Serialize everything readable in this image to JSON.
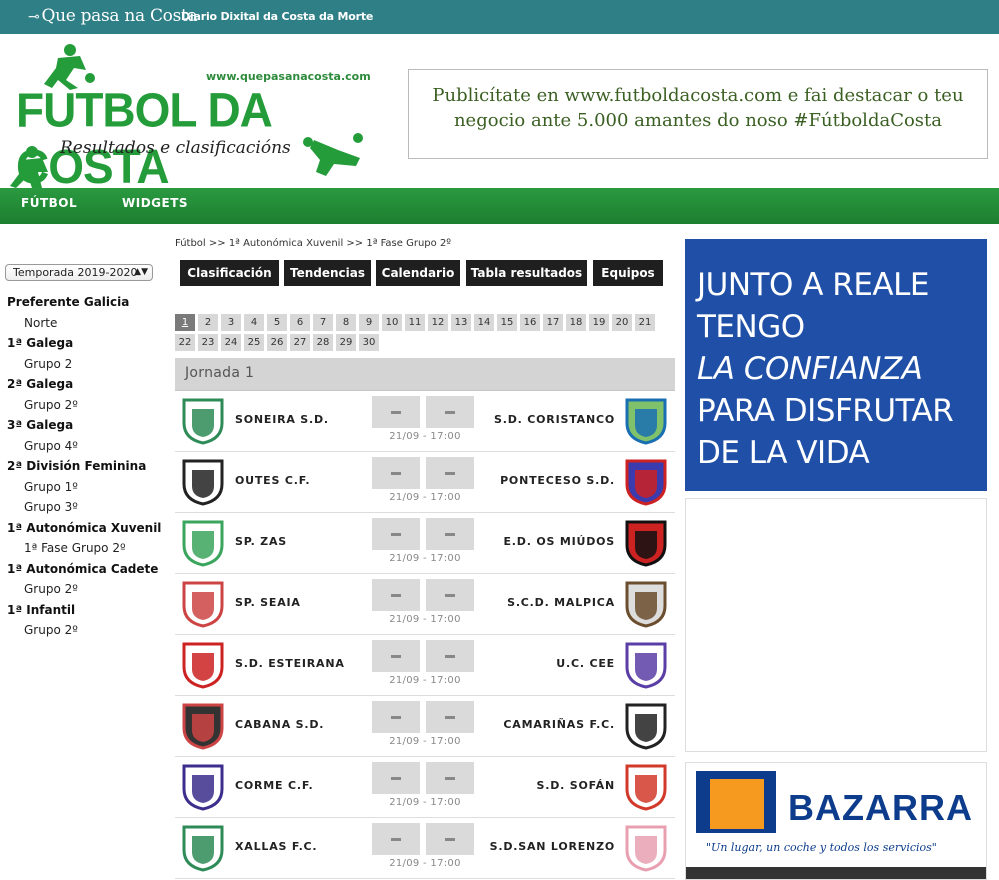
{
  "topbar": {
    "brand": "Que pasa na Costa",
    "tagline": "Diario Dixital da Costa da Morte"
  },
  "logo": {
    "url": "www.quepasanacosta.com",
    "title": "FUTBOL DA COSTA",
    "subtitle": "Resultados e clasificacións"
  },
  "header_ad": {
    "line1": "Publicítate en www.futboldacosta.com e fai destacar o teu",
    "line2": "negocio ante 5.000 amantes do noso #FútboldaCosta"
  },
  "nav": [
    "FÚTBOL",
    "WIDGETS"
  ],
  "season": "Temporada 2019-2020",
  "sidebar": [
    {
      "type": "cat",
      "label": "Preferente Galicia"
    },
    {
      "type": "grp",
      "label": "Norte"
    },
    {
      "type": "cat",
      "label": "1ª Galega"
    },
    {
      "type": "grp",
      "label": "Grupo 2"
    },
    {
      "type": "cat",
      "label": "2ª Galega"
    },
    {
      "type": "grp",
      "label": "Grupo 2º"
    },
    {
      "type": "cat",
      "label": "3ª Galega"
    },
    {
      "type": "grp",
      "label": "Grupo 4º"
    },
    {
      "type": "cat",
      "label": "2ª División Feminina"
    },
    {
      "type": "grp",
      "label": "Grupo 1º"
    },
    {
      "type": "grp",
      "label": "Grupo 3º"
    },
    {
      "type": "cat",
      "label": "1ª Autonómica Xuvenil"
    },
    {
      "type": "grp",
      "label": "1ª Fase Grupo 2º"
    },
    {
      "type": "cat",
      "label": "1ª Autonómica Cadete"
    },
    {
      "type": "grp",
      "label": "Grupo 2º"
    },
    {
      "type": "cat",
      "label": "1ª Infantil"
    },
    {
      "type": "grp",
      "label": "Grupo 2º"
    }
  ],
  "breadcrumb": "Fútbol  >> 1ª Autonómica Xuvenil  >> 1ª Fase Grupo 2º",
  "tabs": [
    "Clasificación",
    "Tendencias",
    "Calendario",
    "Tabla resultados",
    "Equipos"
  ],
  "rounds": [
    "1",
    "2",
    "3",
    "4",
    "5",
    "6",
    "7",
    "8",
    "9",
    "10",
    "11",
    "12",
    "13",
    "14",
    "15",
    "16",
    "17",
    "18",
    "19",
    "20",
    "21",
    "22",
    "23",
    "24",
    "25",
    "26",
    "27",
    "28",
    "29",
    "30"
  ],
  "selected_round": "1",
  "jornada_title": "Jornada 1",
  "matches": [
    {
      "home": "SONEIRA S.D.",
      "away": "S.D. CORISTANCO",
      "when": "21/09 - 17:00"
    },
    {
      "home": "OUTES C.F.",
      "away": "PONTECESO S.D.",
      "when": "21/09 - 17:00"
    },
    {
      "home": "SP. ZAS",
      "away": "E.D. OS MIÚDOS",
      "when": "21/09 - 17:00"
    },
    {
      "home": "SP. SEAIA",
      "away": "S.C.D. MALPICA",
      "when": "21/09 - 17:00"
    },
    {
      "home": "S.D. ESTEIRANA",
      "away": "U.C. CEE",
      "when": "21/09 - 17:00"
    },
    {
      "home": "CABANA S.D.",
      "away": "CAMARIÑAS F.C.",
      "when": "21/09 - 17:00"
    },
    {
      "home": "CORME C.F.",
      "away": "S.D. SOFÁN",
      "when": "21/09 - 17:00"
    },
    {
      "home": "XALLAS F.C.",
      "away": "S.D.SAN LORENZO",
      "when": "21/09 - 17:00"
    }
  ],
  "side_ad": {
    "lines": [
      "JUNTO A REALE",
      "TENGO",
      "LA CONFIANZA",
      "PARA DISFRUTAR",
      "DE LA VIDA"
    ]
  },
  "bazarra_ad": {
    "name": "BAZARRA",
    "slogan": "\"Un lugar, un coche y todos los servicios\""
  },
  "colors": {
    "topbar": "#2f7f86",
    "nav": "#249c3a",
    "ad_blue": "#1f4fa6",
    "tab": "#1f1f1f"
  }
}
